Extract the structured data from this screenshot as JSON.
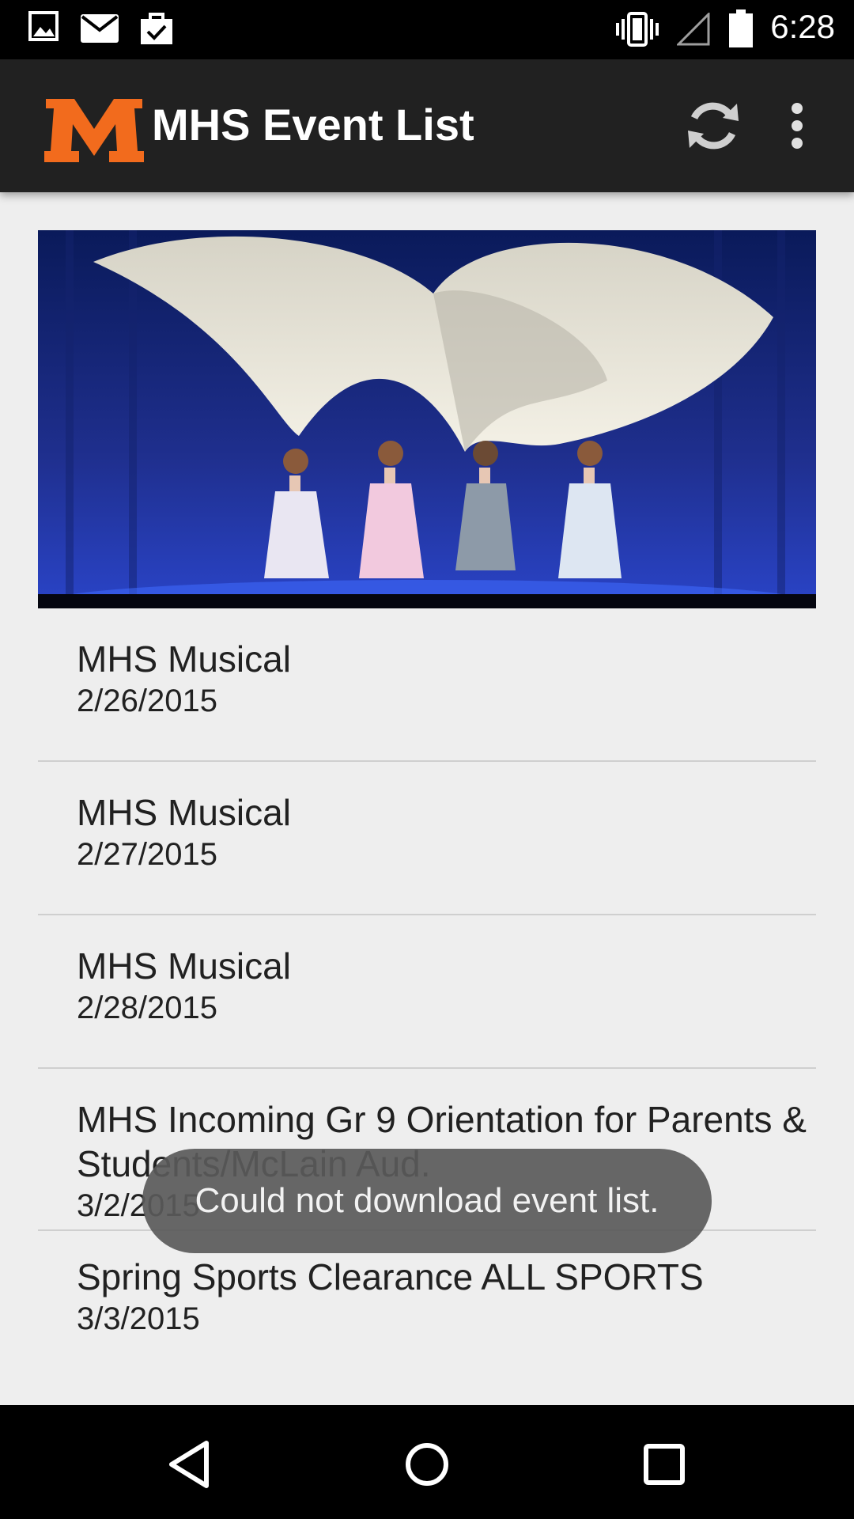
{
  "status_bar": {
    "time": "6:28",
    "left_icons": [
      "image-icon",
      "mail-icon",
      "clipboard-check-icon"
    ],
    "right_icons": [
      "vibrate-icon",
      "signal-icon",
      "battery-icon"
    ]
  },
  "action_bar": {
    "logo_icon": "m-logo-icon",
    "title": "MHS Event List",
    "actions": [
      "refresh-icon",
      "overflow-menu-icon"
    ],
    "logo_color": "#f26b1d",
    "background": "#212121"
  },
  "events": [
    {
      "title": "MHS Musical",
      "date": "2/26/2015"
    },
    {
      "title": "MHS Musical",
      "date": "2/27/2015"
    },
    {
      "title": "MHS Musical",
      "date": "2/28/2015"
    },
    {
      "title": "MHS Incoming Gr 9 Orientation for Parents & Students/McLain Aud.",
      "date": "3/2/2015"
    },
    {
      "title": "Spring Sports Clearance ALL SPORTS",
      "date": "3/3/2015"
    }
  ],
  "toast": {
    "message": "Could not download event list."
  },
  "nav_bar": {
    "buttons": [
      "back-icon",
      "home-icon",
      "recents-icon"
    ]
  }
}
